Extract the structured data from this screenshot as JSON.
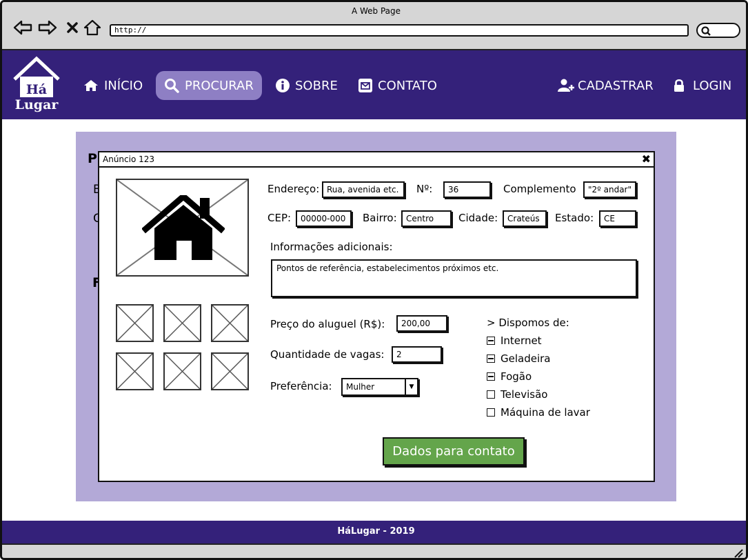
{
  "browser": {
    "window_title": "A Web Page",
    "url": "http://"
  },
  "site": {
    "logo_line1": "Há",
    "logo_line2": "Lugar",
    "nav": [
      {
        "label": "INÍCIO",
        "icon": "home-icon"
      },
      {
        "label": "PROCURAR",
        "icon": "search-icon",
        "active": true
      },
      {
        "label": "SOBRE",
        "icon": "info-icon"
      },
      {
        "label": "CONTATO",
        "icon": "envelope-icon"
      }
    ],
    "cadastrar_label": "CADASTRAR",
    "login_label": "LOGIN"
  },
  "background": {
    "letters": [
      "P",
      "B",
      "C",
      "F"
    ]
  },
  "dialog": {
    "title": "Anúncio 123",
    "close_symbol": "✖",
    "address": {
      "endereco_label": "Endereço:",
      "endereco_value": "Rua, avenida etc.",
      "numero_label": "Nº:",
      "numero_value": "36",
      "complemento_label": "Complemento",
      "complemento_value": "\"2º andar\"",
      "cep_label": "CEP:",
      "cep_value": "00000-000",
      "bairro_label": "Bairro:",
      "bairro_value": "Centro",
      "cidade_label": "Cidade:",
      "cidade_value": "Crateús",
      "estado_label": "Estado:",
      "estado_value": "CE"
    },
    "info_label": "Informações adicionais:",
    "info_value": "Pontos de referência, estabelecimentos próximos etc.",
    "preco_label": "Preço do aluguel (R$):",
    "preco_value": "200,00",
    "vagas_label": "Quantidade de vagas:",
    "vagas_value": "2",
    "preferencia_label": "Preferência:",
    "preferencia_value": "Mulher",
    "amenities_header": "> Dispomos de:",
    "amenities": [
      {
        "label": "Internet",
        "checked": true
      },
      {
        "label": "Geladeira",
        "checked": true
      },
      {
        "label": "Fogão",
        "checked": true
      },
      {
        "label": "Televisão",
        "checked": false
      },
      {
        "label": "Máquina de lavar",
        "checked": false
      }
    ],
    "contact_button": "Dados para contato"
  },
  "footer": {
    "text": "HáLugar - 2019"
  },
  "colors": {
    "brand_purple": "#34217a",
    "active_nav": "#8e7fc4",
    "panel_lavender": "#b3a9d7",
    "contact_green": "#64a54b"
  }
}
